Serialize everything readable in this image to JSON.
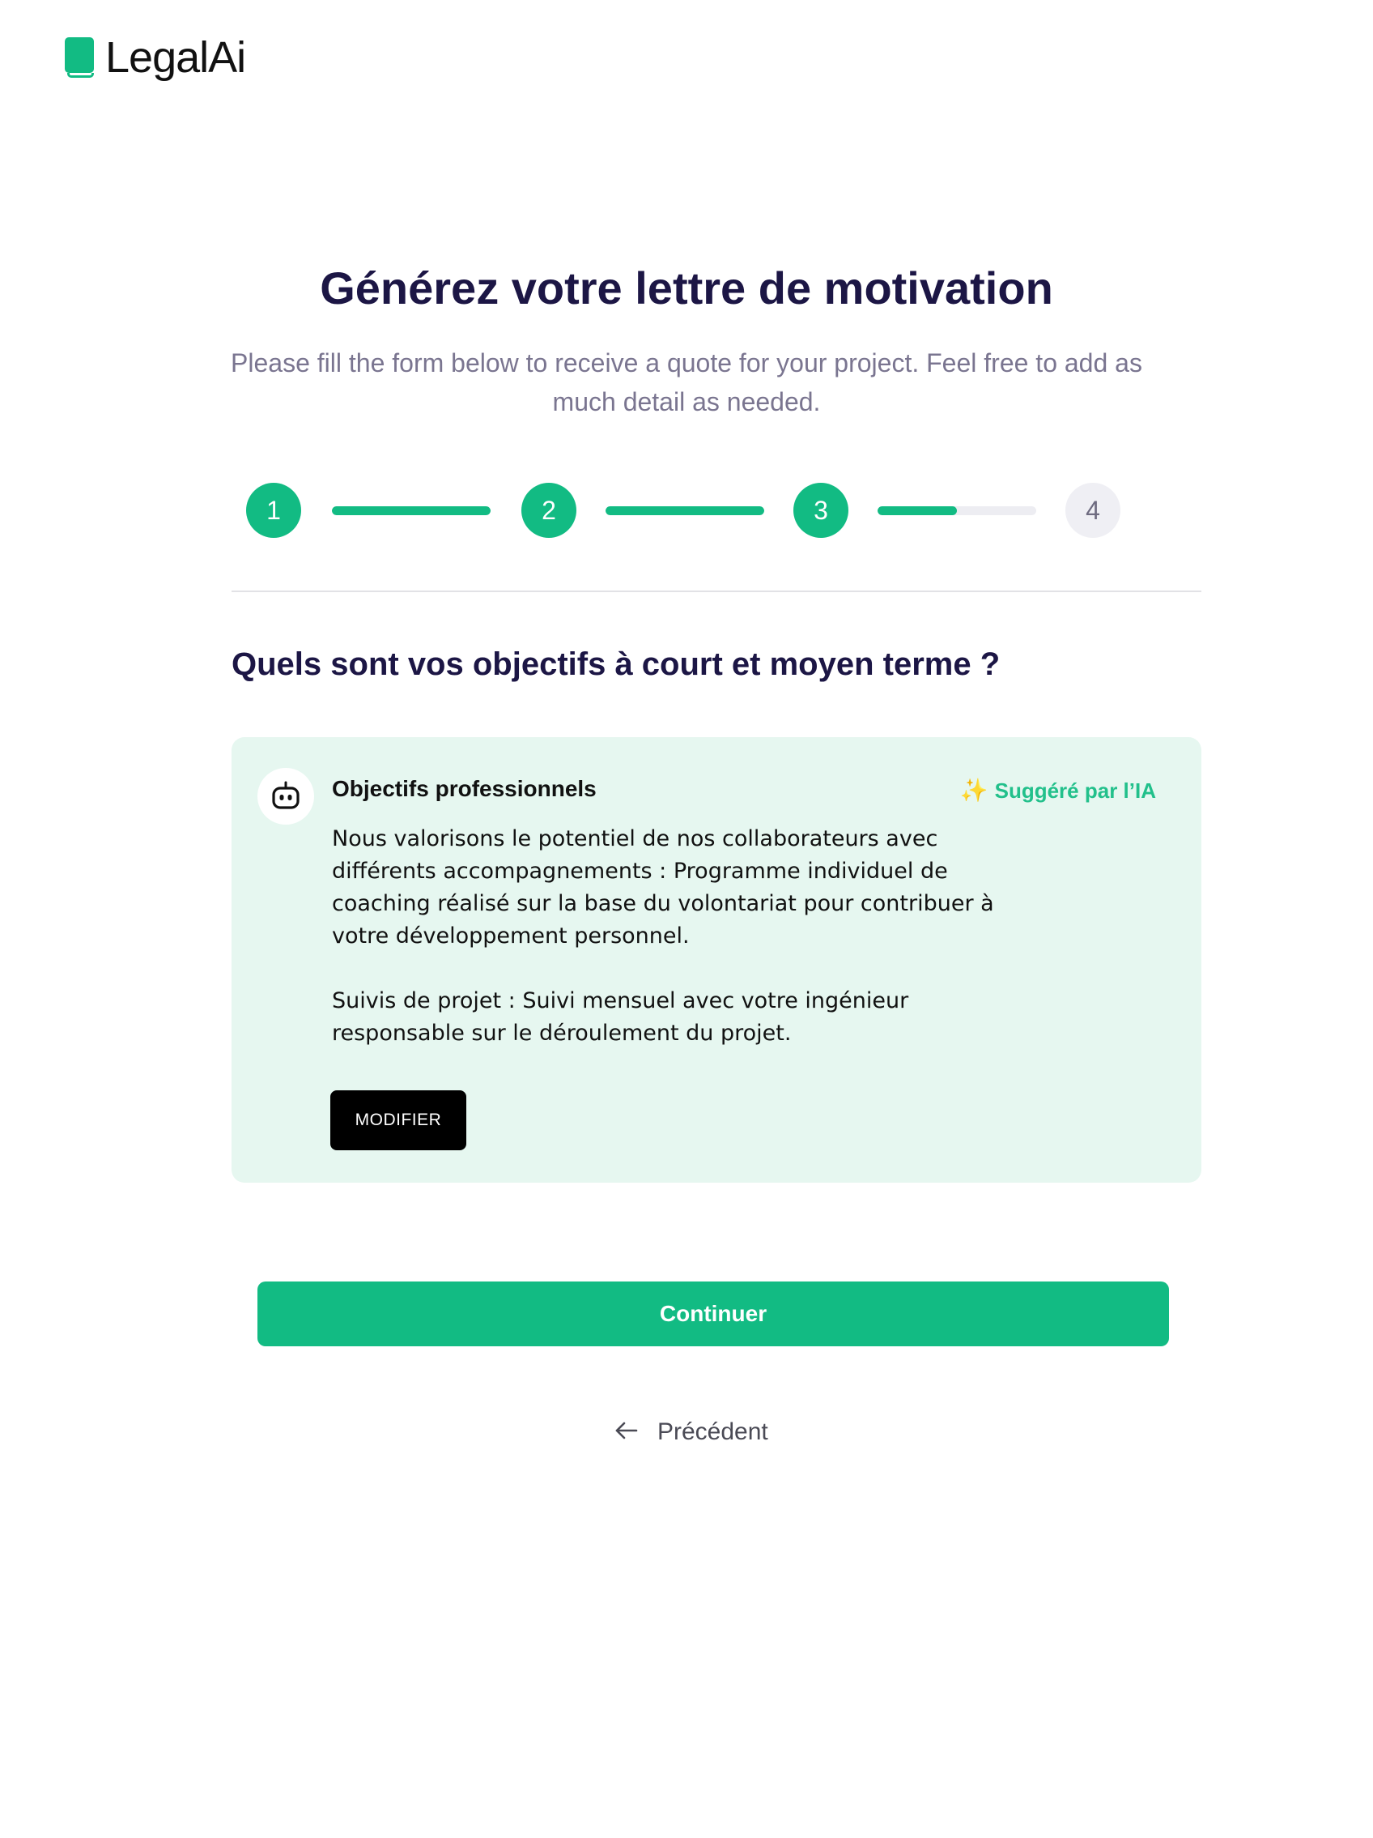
{
  "brand": {
    "name": "LegalAi",
    "accent_color": "#12bb83",
    "logo_icon": "book-icon"
  },
  "header": {
    "title": "Générez votre lettre de motivation",
    "subtitle": "Please fill the form below to receive a quote for your project. Feel free to add as much detail as needed."
  },
  "stepper": {
    "steps": [
      {
        "label": "1",
        "state": "completed"
      },
      {
        "label": "2",
        "state": "completed"
      },
      {
        "label": "3",
        "state": "current"
      },
      {
        "label": "4",
        "state": "upcoming"
      }
    ],
    "connectors_progress": [
      1.0,
      1.0,
      0.5
    ]
  },
  "question": {
    "text": "Quels sont vos objectifs à court et moyen terme ?"
  },
  "suggestion": {
    "icon": "robot-icon",
    "title": "Objectifs professionnels",
    "badge_icon": "sparkle-icon",
    "badge": "Suggéré par l’IA",
    "paragraphs": [
      "Nous valorisons le potentiel de nos collaborateurs avec différents accompagnements : Programme individuel de coaching réalisé sur la base du volontariat pour contribuer à votre développement personnel.",
      "Suivis de projet : Suivi mensuel avec votre ingénieur responsable sur le déroulement du projet."
    ],
    "modify_label": "MODIFIER",
    "background_color": "#e6f7f0"
  },
  "actions": {
    "continue_label": "Continuer",
    "previous_icon": "arrow-left-icon",
    "previous_label": "Précédent"
  }
}
